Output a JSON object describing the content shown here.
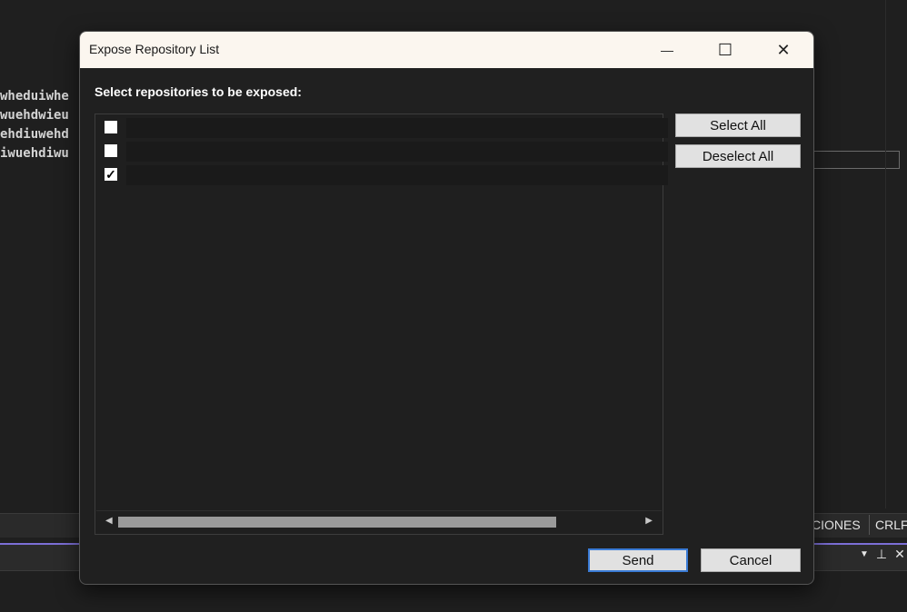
{
  "background_editor": {
    "code_lines": [
      "wheduiwhe",
      "wuehdwieu",
      "ehdiuwehd",
      "iwuehdiwu"
    ],
    "status_items": [
      "CIONES",
      "CRLF"
    ],
    "panel_icons": [
      "dropdown-icon",
      "pin-icon",
      "close-icon"
    ]
  },
  "dialog": {
    "title": "Expose Repository List",
    "controls": {
      "minimize": "—",
      "maximize": "☐",
      "close": "✕"
    },
    "instruction": "Select repositories to be exposed:",
    "repositories": [
      {
        "label": "",
        "checked": false
      },
      {
        "label": "",
        "checked": false
      },
      {
        "label": "",
        "checked": true
      }
    ],
    "buttons": {
      "select_all": "Select All",
      "deselect_all": "Deselect All",
      "send": "Send",
      "cancel": "Cancel"
    },
    "scroll_arrows": {
      "left": "◀",
      "right": "▶"
    },
    "check_mark": "✓"
  }
}
